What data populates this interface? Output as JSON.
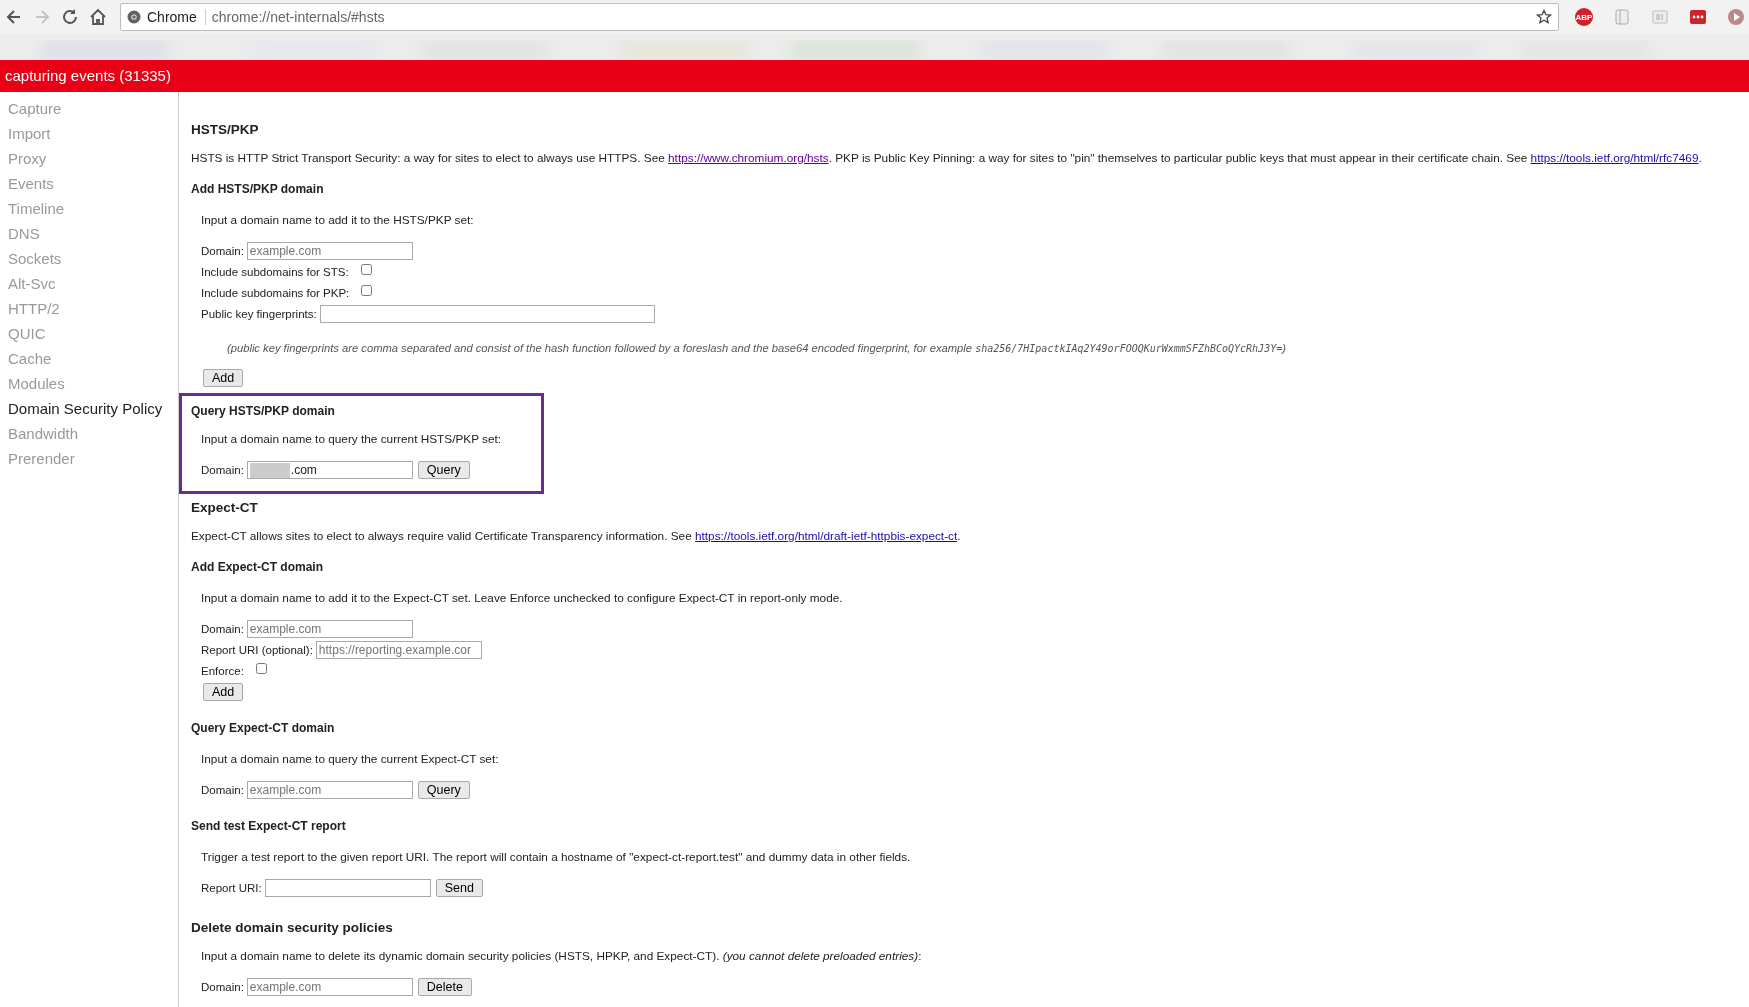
{
  "browser": {
    "back_disabled": false,
    "forward_disabled": true,
    "site_label": "Chrome",
    "url": "chrome://net-internals/#hsts",
    "extensions": [
      {
        "kind": "abp",
        "text": "ABP"
      },
      {
        "kind": "scroll"
      },
      {
        "kind": "reader"
      },
      {
        "kind": "dots"
      },
      {
        "kind": "play"
      }
    ]
  },
  "status_bar": {
    "text": "capturing events (31335)"
  },
  "sidebar": {
    "items": [
      {
        "label": "Capture",
        "selected": false
      },
      {
        "label": "Import",
        "selected": false
      },
      {
        "label": "Proxy",
        "selected": false
      },
      {
        "label": "Events",
        "selected": false
      },
      {
        "label": "Timeline",
        "selected": false
      },
      {
        "label": "DNS",
        "selected": false
      },
      {
        "label": "Sockets",
        "selected": false
      },
      {
        "label": "Alt-Svc",
        "selected": false
      },
      {
        "label": "HTTP/2",
        "selected": false
      },
      {
        "label": "QUIC",
        "selected": false
      },
      {
        "label": "Cache",
        "selected": false
      },
      {
        "label": "Modules",
        "selected": false
      },
      {
        "label": "Domain Security Policy",
        "selected": true
      },
      {
        "label": "Bandwidth",
        "selected": false
      },
      {
        "label": "Prerender",
        "selected": false
      }
    ]
  },
  "content": [
    {
      "kind": "title",
      "text": "HSTS/PKP"
    },
    {
      "kind": "paragraph",
      "parts": [
        {
          "text": "HSTS is HTTP Strict Transport Security: a way for sites to elect to always use HTTPS. See "
        },
        {
          "link": "https://www.chromium.org/hsts",
          "visited": true
        },
        {
          "text": ". PKP is Public Key Pinning: a way for sites to \"pin\" themselves to particular public keys that must appear in their certificate chain. See "
        },
        {
          "link": "https://tools.ietf.org/html/rfc7469",
          "visited": false
        },
        {
          "text": "."
        }
      ]
    },
    {
      "kind": "heading",
      "text": "Add HSTS/PKP domain"
    },
    {
      "kind": "prompt",
      "text": "Input a domain name to add it to the HSTS/PKP set:"
    },
    {
      "kind": "row",
      "items": [
        {
          "kind": "label",
          "text": "Domain:"
        },
        {
          "kind": "input",
          "placeholder": "example.com"
        }
      ]
    },
    {
      "kind": "row",
      "items": [
        {
          "kind": "label",
          "text": "Include subdomains for STS:"
        },
        {
          "kind": "checkbox",
          "checked": false
        }
      ]
    },
    {
      "kind": "row",
      "items": [
        {
          "kind": "label",
          "text": "Include subdomains for PKP:"
        },
        {
          "kind": "checkbox",
          "checked": false
        }
      ]
    },
    {
      "kind": "row",
      "items": [
        {
          "kind": "label",
          "text": "Public key fingerprints:"
        },
        {
          "kind": "wide_input"
        }
      ]
    },
    {
      "kind": "hint",
      "parts": [
        {
          "text": "(public key fingerprints are comma separated and consist of the hash function followed by a foreslash and the base64 encoded fingerprint, for example "
        },
        {
          "code": "sha256/7HIpactkIAq2Y49orFOOQKurWxmmSFZhBCoQYcRhJ3Y="
        },
        {
          "text": ")"
        }
      ]
    },
    {
      "kind": "row",
      "items": [
        {
          "kind": "button",
          "text": "Add"
        }
      ]
    },
    {
      "kind": "highlight",
      "children": [
        {
          "kind": "heading",
          "text": "Query HSTS/PKP domain"
        },
        {
          "kind": "prompt",
          "text": "Input a domain name to query the current HSTS/PKP set:"
        },
        {
          "kind": "row",
          "items": [
            {
              "kind": "label",
              "text": "Domain:"
            },
            {
              "kind": "input",
              "value": ".com",
              "redacted": true
            },
            {
              "kind": "button",
              "text": "Query"
            }
          ]
        }
      ]
    },
    {
      "kind": "title",
      "text": "Expect-CT"
    },
    {
      "kind": "paragraph",
      "parts": [
        {
          "text": "Expect-CT allows sites to elect to always require valid Certificate Transparency information. See "
        },
        {
          "link": "https://tools.ietf.org/html/draft-ietf-httpbis-expect-ct",
          "visited": false
        },
        {
          "text": "."
        }
      ]
    },
    {
      "kind": "heading",
      "text": "Add Expect-CT domain"
    },
    {
      "kind": "prompt",
      "text": "Input a domain name to add it to the Expect-CT set. Leave Enforce unchecked to configure Expect-CT in report-only mode."
    },
    {
      "kind": "row",
      "items": [
        {
          "kind": "label",
          "text": "Domain:"
        },
        {
          "kind": "input",
          "placeholder": "example.com"
        }
      ]
    },
    {
      "kind": "row",
      "items": [
        {
          "kind": "label",
          "text": "Report URI (optional):"
        },
        {
          "kind": "input",
          "placeholder": "https://reporting.example.cor"
        }
      ]
    },
    {
      "kind": "row",
      "items": [
        {
          "kind": "label",
          "text": "Enforce:"
        },
        {
          "kind": "checkbox",
          "checked": false
        }
      ]
    },
    {
      "kind": "row",
      "items": [
        {
          "kind": "button",
          "text": "Add"
        }
      ]
    },
    {
      "kind": "heading",
      "text": "Query Expect-CT domain"
    },
    {
      "kind": "prompt",
      "text": "Input a domain name to query the current Expect-CT set:"
    },
    {
      "kind": "row",
      "items": [
        {
          "kind": "label",
          "text": "Domain:"
        },
        {
          "kind": "input",
          "placeholder": "example.com"
        },
        {
          "kind": "button",
          "text": "Query"
        }
      ]
    },
    {
      "kind": "heading",
      "text": "Send test Expect-CT report"
    },
    {
      "kind": "prompt",
      "text": "Trigger a test report to the given report URI. The report will contain a hostname of \"expect-ct-report.test\" and dummy data in other fields."
    },
    {
      "kind": "row",
      "items": [
        {
          "kind": "label",
          "text": "Report URI:"
        },
        {
          "kind": "input"
        },
        {
          "kind": "button",
          "text": "Send"
        }
      ]
    },
    {
      "kind": "title",
      "text": "Delete domain security policies"
    },
    {
      "kind": "prompt",
      "text": "Input a domain name to delete its dynamic domain security policies (HSTS, HPKP, and Expect-CT). *(you cannot delete preloaded entries)*:"
    },
    {
      "kind": "row",
      "items": [
        {
          "kind": "label",
          "text": "Domain:"
        },
        {
          "kind": "input",
          "placeholder": "example.com"
        },
        {
          "kind": "button",
          "text": "Delete"
        }
      ]
    }
  ]
}
